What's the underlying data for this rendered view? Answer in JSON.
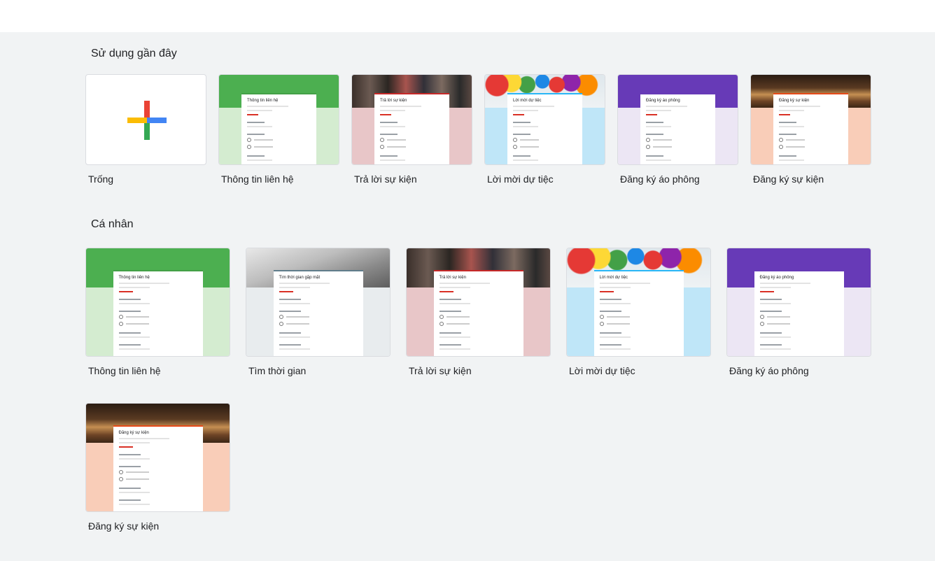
{
  "sections": {
    "recent": {
      "title": "Sử dụng gần đây",
      "items": [
        {
          "label": "Trống",
          "kind": "blank",
          "icon": "plus-icon"
        },
        {
          "label": "Thông tin liên hệ",
          "form_title": "Thông tin liên hệ",
          "banner_color": "#4caf50",
          "lower_color": "#d4ecd0",
          "accent": "#43a047"
        },
        {
          "label": "Trả lời sự kiện",
          "form_title": "Trả lời sự kiện",
          "banner_photo": "people",
          "lower_color": "#e8c6c8",
          "accent": "#c62828"
        },
        {
          "label": "Lời mời dự tiệc",
          "form_title": "Lời mời dự tiệc",
          "banner_photo": "balloons",
          "lower_color": "#bfe6f8",
          "accent": "#29b6f6"
        },
        {
          "label": "Đăng ký áo phông",
          "form_title": "Đăng ký áo phông",
          "banner_color": "#673ab7",
          "lower_color": "#ece6f4",
          "accent": "#673ab7"
        },
        {
          "label": "Đăng ký sự kiện",
          "form_title": "Đăng ký sự kiện",
          "banner_photo": "theater",
          "lower_color": "#f9cdb8",
          "accent": "#e64a19"
        }
      ]
    },
    "personal": {
      "title": "Cá nhân",
      "items": [
        {
          "label": "Thông tin liên hệ",
          "form_title": "Thông tin liên hệ",
          "banner_color": "#4caf50",
          "lower_color": "#d4ecd0",
          "accent": "#43a047"
        },
        {
          "label": "Tìm thời gian",
          "form_title": "Tìm thời gian gặp mặt",
          "banner_photo": "notebook",
          "lower_color": "#e8ecee",
          "accent": "#607d8b"
        },
        {
          "label": "Trả lời sự kiện",
          "form_title": "Trả lời sự kiện",
          "banner_photo": "people",
          "lower_color": "#e8c6c8",
          "accent": "#c62828"
        },
        {
          "label": "Lời mời dự tiệc",
          "form_title": "Lời mời dự tiệc",
          "banner_photo": "balloons",
          "lower_color": "#bfe6f8",
          "accent": "#29b6f6"
        },
        {
          "label": "Đăng ký áo phông",
          "form_title": "Đăng ký áo phông",
          "banner_color": "#673ab7",
          "lower_color": "#ece6f4",
          "accent": "#673ab7"
        },
        {
          "label": "Đăng ký sự kiện",
          "form_title": "Đăng ký sự kiện",
          "banner_photo": "theater",
          "lower_color": "#f9cdb8",
          "accent": "#e64a19"
        }
      ]
    }
  }
}
